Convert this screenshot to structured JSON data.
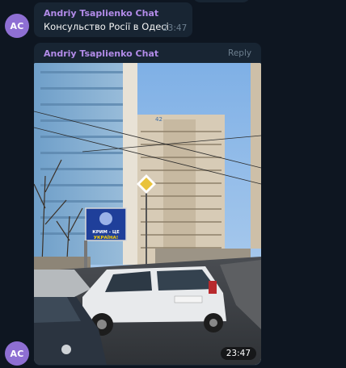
{
  "messages": [
    {
      "avatar_initials": "AC",
      "sender": "Andriy Tsaplienko Chat",
      "text": "Консульство Росії в Одесі",
      "time": "23:47"
    },
    {
      "avatar_initials": "AC",
      "sender": "Andriy Tsaplienko Chat",
      "reply_label": "Reply",
      "photo": {
        "building_number": "42",
        "billboard_line1": "КРИМ - ЦЕ",
        "billboard_line2": "УКРАЇНА!"
      },
      "time": "23:47"
    }
  ],
  "colors": {
    "background": "#0e1621",
    "bubble": "#182533",
    "sender_name": "#b28be8",
    "avatar": "#8e6fd3",
    "meta_text": "#6d7f8f"
  }
}
